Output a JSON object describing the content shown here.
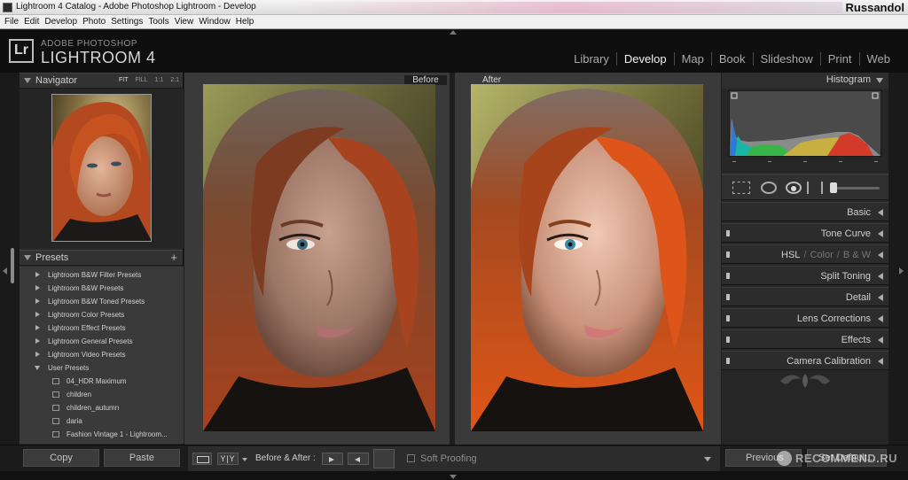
{
  "window": {
    "title": "Lightroom 4 Catalog - Adobe Photoshop Lightroom - Develop",
    "user": "Russandol"
  },
  "menu": [
    "File",
    "Edit",
    "Develop",
    "Photo",
    "Settings",
    "Tools",
    "View",
    "Window",
    "Help"
  ],
  "identity": {
    "badge": "Lr",
    "small": "ADOBE PHOTOSHOP",
    "large": "LIGHTROOM 4"
  },
  "modules": [
    "Library",
    "Develop",
    "Map",
    "Book",
    "Slideshow",
    "Print",
    "Web"
  ],
  "active_module": "Develop",
  "navigator": {
    "title": "Navigator",
    "zoom": [
      "FIT",
      "FILL",
      "1:1",
      "2:1"
    ],
    "zoom_selected": "FIT"
  },
  "presets": {
    "title": "Presets",
    "add": "+",
    "folders": [
      "Lightroom B&W Filter Presets",
      "Lightroom B&W Presets",
      "Lightroom B&W Toned Presets",
      "Lightroom Color Presets",
      "Lightroom Effect Presets",
      "Lightroom General Presets",
      "Lightroom Video Presets",
      "User Presets"
    ],
    "user_presets": [
      "04_HDR Maximum",
      "children",
      "children_autumn",
      "daria",
      "Fashion Vintage 1 - Lightroom..."
    ]
  },
  "compare": {
    "before": "Before",
    "after": "After"
  },
  "histogram": {
    "title": "Histogram"
  },
  "panels": {
    "basic": "Basic",
    "tone_curve": "Tone Curve",
    "hsl": [
      "HSL",
      "Color",
      "B & W"
    ],
    "split_toning": "Split Toning",
    "detail": "Detail",
    "lens": "Lens Corrections",
    "effects": "Effects",
    "camera": "Camera Calibration"
  },
  "toolbar": {
    "copy": "Copy",
    "paste": "Paste",
    "yy": "Y|Y",
    "before_after": "Before & After :",
    "soft_proofing": "Soft Proofing",
    "soft_proofing_checked": false,
    "previous": "Previous",
    "reset": "Set Default..."
  },
  "watermark": "RECOMMEND.RU",
  "colors": {
    "accent": "#f2f2f2",
    "panel": "#2a2a2a",
    "hair": "#b8431c",
    "hair_after": "#d9531a"
  }
}
